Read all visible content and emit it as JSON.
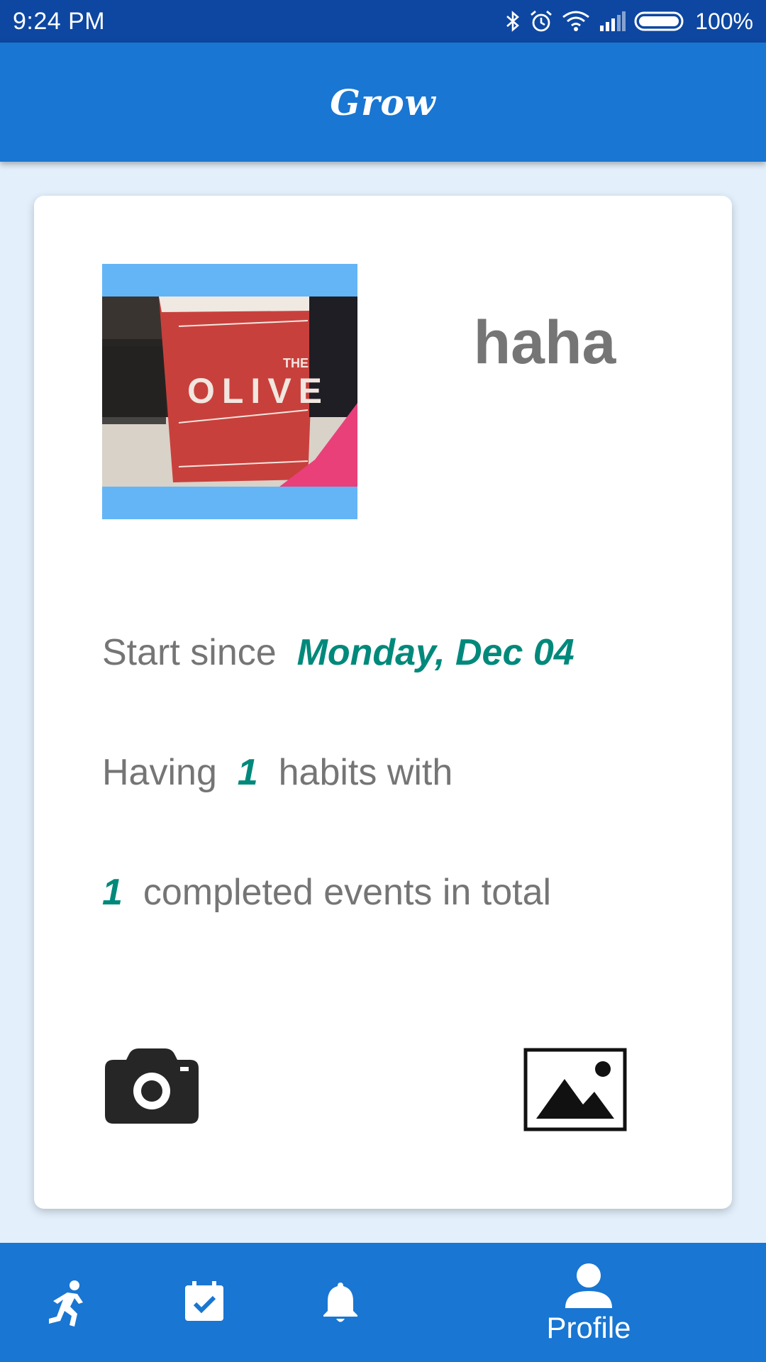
{
  "status_bar": {
    "time": "9:24  PM",
    "battery": "100%"
  },
  "app_bar": {
    "title": "Grow"
  },
  "profile": {
    "name": "haha",
    "photo_alt": "profile photo",
    "start_label": "Start since",
    "start_date": "Monday, Dec 04",
    "habits_prefix": "Having",
    "habits_count": "1",
    "habits_suffix": "habits with",
    "events_count": "1",
    "events_suffix": "completed events in total"
  },
  "bottom_nav": {
    "items": [
      {
        "icon": "running-icon",
        "label": ""
      },
      {
        "icon": "calendar-check-icon",
        "label": ""
      },
      {
        "icon": "bell-icon",
        "label": ""
      },
      {
        "icon": "person-icon",
        "label": "Profile"
      }
    ]
  },
  "colors": {
    "status_bar": "#0d47a1",
    "primary": "#1976d2",
    "background": "#e3f0fc",
    "accent_teal": "#00897b",
    "text_gray": "#757575"
  }
}
